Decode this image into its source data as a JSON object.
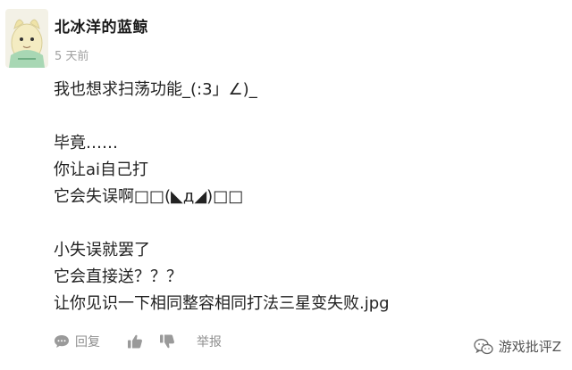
{
  "comment": {
    "username": "北冰洋的蓝鲸",
    "timestamp": "5 天前",
    "lines": [
      "我也想求扫荡功能_(:3」∠)_",
      "",
      "毕竟……",
      "你让ai自己打",
      "它会失误啊□□(◣д◢)□□",
      "",
      "小失误就罢了",
      "它会直接送？？？",
      "让你见识一下相同整容相同打法三星变失败.jpg"
    ],
    "actions": {
      "reply_label": "回复",
      "report_label": "举报"
    }
  },
  "watermark": {
    "text": "游戏批评Z"
  },
  "icons": {
    "avatar": "avatar-image",
    "reply": "comment-bubble-icon",
    "like": "thumbs-up-icon",
    "dislike": "thumbs-down-icon",
    "watermark": "wechat-logo-icon"
  },
  "colors": {
    "text": "#222222",
    "muted": "#a0a0a0",
    "action": "#8f8f8f"
  }
}
